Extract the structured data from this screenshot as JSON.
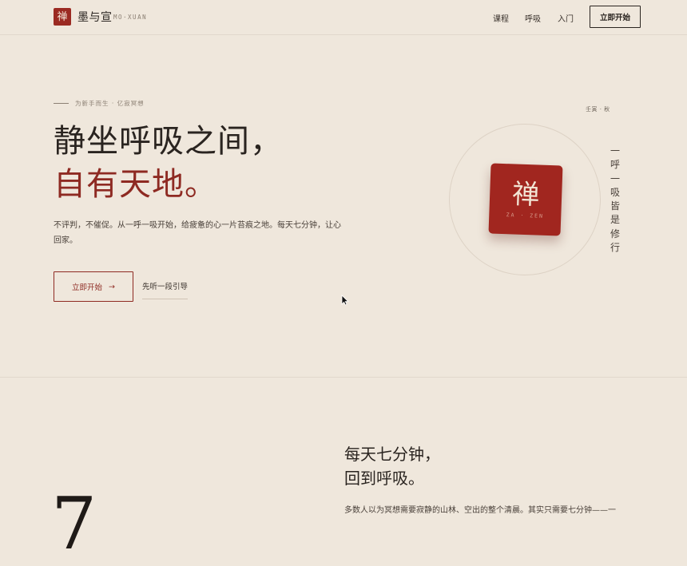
{
  "header": {
    "logo_char": "禅",
    "brand_name": "墨与宣",
    "brand_latin": "MO·XUAN",
    "nav": [
      "课程",
      "呼吸",
      "入门"
    ],
    "cta_label": "立即开始"
  },
  "hero": {
    "eyebrow": "为新手而生 · 亿寂冥想",
    "title_line1": "静坐呼吸之间，",
    "title_line2": "自有天地。",
    "description": "不评判，不催促。从一呼一吸开始，给疲惫的心一片苔痕之地。每天七分钟，让心回家。",
    "primary_button": "立即开始",
    "primary_button_arrow": "→",
    "secondary_button": "先听一段引导"
  },
  "visual": {
    "season": "壬寅 · 秋",
    "card_char": "禅",
    "card_latin": "ZA · ZEN",
    "vertical_text": "一呼一吸皆是修行"
  },
  "section": {
    "title_line1": "每天七分钟，",
    "title_line2": "回到呼吸。",
    "big_numeral": "7",
    "body": "多数人以为冥想需要寂静的山林、空出的整个清晨。其实只需要七分钟——一"
  },
  "colors": {
    "background": "#efe7dc",
    "accent": "#8e2a22",
    "text": "#2a2420"
  }
}
